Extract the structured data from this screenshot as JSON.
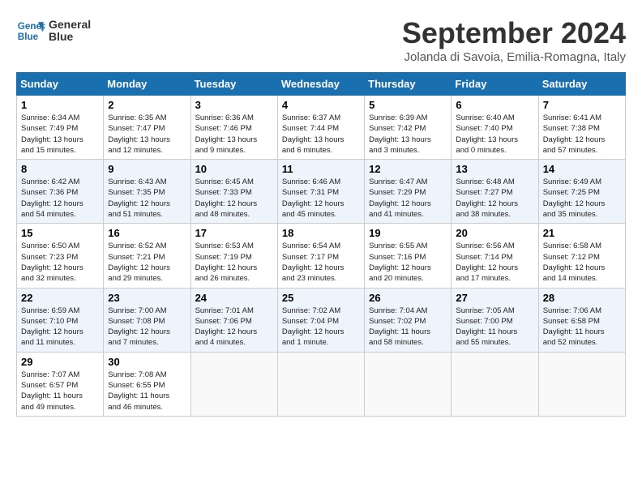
{
  "header": {
    "logo_line1": "General",
    "logo_line2": "Blue",
    "month": "September 2024",
    "location": "Jolanda di Savoia, Emilia-Romagna, Italy"
  },
  "days_of_week": [
    "Sunday",
    "Monday",
    "Tuesday",
    "Wednesday",
    "Thursday",
    "Friday",
    "Saturday"
  ],
  "weeks": [
    [
      {
        "day": 1,
        "info": "Sunrise: 6:34 AM\nSunset: 7:49 PM\nDaylight: 13 hours\nand 15 minutes."
      },
      {
        "day": 2,
        "info": "Sunrise: 6:35 AM\nSunset: 7:47 PM\nDaylight: 13 hours\nand 12 minutes."
      },
      {
        "day": 3,
        "info": "Sunrise: 6:36 AM\nSunset: 7:46 PM\nDaylight: 13 hours\nand 9 minutes."
      },
      {
        "day": 4,
        "info": "Sunrise: 6:37 AM\nSunset: 7:44 PM\nDaylight: 13 hours\nand 6 minutes."
      },
      {
        "day": 5,
        "info": "Sunrise: 6:39 AM\nSunset: 7:42 PM\nDaylight: 13 hours\nand 3 minutes."
      },
      {
        "day": 6,
        "info": "Sunrise: 6:40 AM\nSunset: 7:40 PM\nDaylight: 13 hours\nand 0 minutes."
      },
      {
        "day": 7,
        "info": "Sunrise: 6:41 AM\nSunset: 7:38 PM\nDaylight: 12 hours\nand 57 minutes."
      }
    ],
    [
      {
        "day": 8,
        "info": "Sunrise: 6:42 AM\nSunset: 7:36 PM\nDaylight: 12 hours\nand 54 minutes."
      },
      {
        "day": 9,
        "info": "Sunrise: 6:43 AM\nSunset: 7:35 PM\nDaylight: 12 hours\nand 51 minutes."
      },
      {
        "day": 10,
        "info": "Sunrise: 6:45 AM\nSunset: 7:33 PM\nDaylight: 12 hours\nand 48 minutes."
      },
      {
        "day": 11,
        "info": "Sunrise: 6:46 AM\nSunset: 7:31 PM\nDaylight: 12 hours\nand 45 minutes."
      },
      {
        "day": 12,
        "info": "Sunrise: 6:47 AM\nSunset: 7:29 PM\nDaylight: 12 hours\nand 41 minutes."
      },
      {
        "day": 13,
        "info": "Sunrise: 6:48 AM\nSunset: 7:27 PM\nDaylight: 12 hours\nand 38 minutes."
      },
      {
        "day": 14,
        "info": "Sunrise: 6:49 AM\nSunset: 7:25 PM\nDaylight: 12 hours\nand 35 minutes."
      }
    ],
    [
      {
        "day": 15,
        "info": "Sunrise: 6:50 AM\nSunset: 7:23 PM\nDaylight: 12 hours\nand 32 minutes."
      },
      {
        "day": 16,
        "info": "Sunrise: 6:52 AM\nSunset: 7:21 PM\nDaylight: 12 hours\nand 29 minutes."
      },
      {
        "day": 17,
        "info": "Sunrise: 6:53 AM\nSunset: 7:19 PM\nDaylight: 12 hours\nand 26 minutes."
      },
      {
        "day": 18,
        "info": "Sunrise: 6:54 AM\nSunset: 7:17 PM\nDaylight: 12 hours\nand 23 minutes."
      },
      {
        "day": 19,
        "info": "Sunrise: 6:55 AM\nSunset: 7:16 PM\nDaylight: 12 hours\nand 20 minutes."
      },
      {
        "day": 20,
        "info": "Sunrise: 6:56 AM\nSunset: 7:14 PM\nDaylight: 12 hours\nand 17 minutes."
      },
      {
        "day": 21,
        "info": "Sunrise: 6:58 AM\nSunset: 7:12 PM\nDaylight: 12 hours\nand 14 minutes."
      }
    ],
    [
      {
        "day": 22,
        "info": "Sunrise: 6:59 AM\nSunset: 7:10 PM\nDaylight: 12 hours\nand 11 minutes."
      },
      {
        "day": 23,
        "info": "Sunrise: 7:00 AM\nSunset: 7:08 PM\nDaylight: 12 hours\nand 7 minutes."
      },
      {
        "day": 24,
        "info": "Sunrise: 7:01 AM\nSunset: 7:06 PM\nDaylight: 12 hours\nand 4 minutes."
      },
      {
        "day": 25,
        "info": "Sunrise: 7:02 AM\nSunset: 7:04 PM\nDaylight: 12 hours\nand 1 minute."
      },
      {
        "day": 26,
        "info": "Sunrise: 7:04 AM\nSunset: 7:02 PM\nDaylight: 11 hours\nand 58 minutes."
      },
      {
        "day": 27,
        "info": "Sunrise: 7:05 AM\nSunset: 7:00 PM\nDaylight: 11 hours\nand 55 minutes."
      },
      {
        "day": 28,
        "info": "Sunrise: 7:06 AM\nSunset: 6:58 PM\nDaylight: 11 hours\nand 52 minutes."
      }
    ],
    [
      {
        "day": 29,
        "info": "Sunrise: 7:07 AM\nSunset: 6:57 PM\nDaylight: 11 hours\nand 49 minutes."
      },
      {
        "day": 30,
        "info": "Sunrise: 7:08 AM\nSunset: 6:55 PM\nDaylight: 11 hours\nand 46 minutes."
      },
      null,
      null,
      null,
      null,
      null
    ]
  ]
}
